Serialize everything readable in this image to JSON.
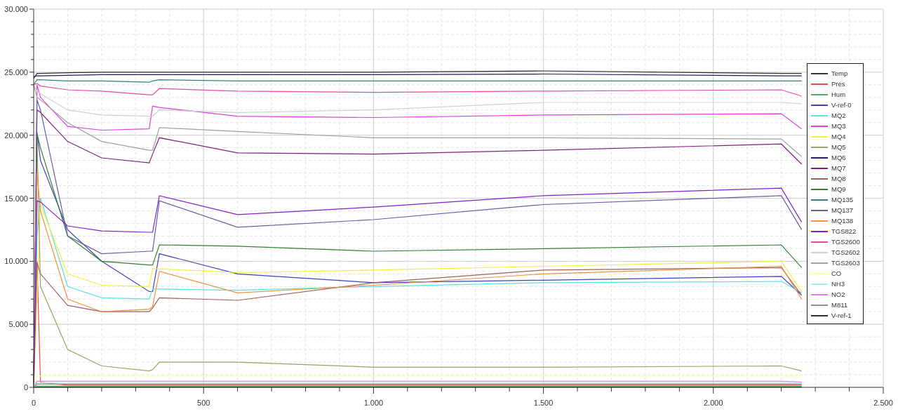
{
  "chart": {
    "chart_data": {
      "type": "line",
      "grid": true,
      "x": [
        0,
        10,
        20,
        100,
        200,
        340,
        350,
        370,
        600,
        1000,
        1500,
        2200,
        2260
      ],
      "xlim": [
        0,
        2500
      ],
      "ylim": [
        0,
        30000
      ],
      "xticks": [
        {
          "value": 0,
          "label": "0"
        },
        {
          "value": 500,
          "label": "500"
        },
        {
          "value": 1000,
          "label": "1.000"
        },
        {
          "value": 1500,
          "label": "1.500"
        },
        {
          "value": 2000,
          "label": "2.000"
        },
        {
          "value": 2500,
          "label": "2.500"
        }
      ],
      "yticks": [
        {
          "value": 0,
          "label": "0"
        },
        {
          "value": 5000,
          "label": "5.000"
        },
        {
          "value": 10000,
          "label": "10.000"
        },
        {
          "value": 15000,
          "label": "15.000"
        },
        {
          "value": 20000,
          "label": "20.000"
        },
        {
          "value": 25000,
          "label": "25.000"
        },
        {
          "value": 30000,
          "label": "30.000"
        }
      ],
      "series": [
        {
          "name": "Temp",
          "color": "#333333",
          "values": [
            0,
            20,
            20,
            20,
            20,
            20,
            20,
            20,
            20,
            20,
            20,
            20,
            20
          ]
        },
        {
          "name": "Pres",
          "color": "#e05050",
          "values": [
            0,
            10000,
            400,
            180,
            180,
            180,
            180,
            180,
            180,
            180,
            180,
            180,
            180
          ]
        },
        {
          "name": "Hum",
          "color": "#40c040",
          "values": [
            100,
            100,
            100,
            100,
            100,
            100,
            100,
            100,
            100,
            100,
            100,
            100,
            100
          ]
        },
        {
          "name": "V-ref-0",
          "color": "#4040c0",
          "values": [
            0,
            20200,
            18000,
            12500,
            10000,
            7600,
            7600,
            10600,
            9000,
            8300,
            8500,
            8800,
            7300
          ]
        },
        {
          "name": "MQ2",
          "color": "#60e0e0",
          "values": [
            0,
            12000,
            15000,
            8000,
            7100,
            7000,
            7800,
            7800,
            7700,
            8000,
            8300,
            8400,
            7500
          ]
        },
        {
          "name": "MQ3",
          "color": "#e040e0",
          "values": [
            0,
            24000,
            23000,
            20700,
            20400,
            20500,
            22300,
            22200,
            21500,
            21400,
            21600,
            21700,
            20500
          ]
        },
        {
          "name": "MQ4",
          "color": "#f0f040",
          "values": [
            0,
            null,
            14500,
            9000,
            8100,
            8000,
            9400,
            9400,
            9100,
            9300,
            9600,
            10000,
            7600
          ]
        },
        {
          "name": "MQ5",
          "color": "#a0a060",
          "values": [
            0,
            19800,
            8000,
            3000,
            1700,
            1300,
            1400,
            2000,
            2000,
            1600,
            1600,
            1700,
            1300
          ]
        },
        {
          "name": "MQ6",
          "color": "#202060",
          "values": [
            24650,
            24700,
            24700,
            24750,
            24800,
            24800,
            24800,
            24800,
            24800,
            24800,
            24850,
            24700,
            24700
          ]
        },
        {
          "name": "MQ7",
          "color": "#802080",
          "values": [
            0,
            22000,
            21800,
            19500,
            18200,
            17800,
            18500,
            19800,
            18600,
            18500,
            18800,
            19300,
            17700
          ]
        },
        {
          "name": "MQ8",
          "color": "#a06060",
          "values": [
            0,
            9900,
            9000,
            6500,
            6000,
            6000,
            6300,
            7100,
            6900,
            8300,
            9300,
            9500,
            7300
          ]
        },
        {
          "name": "MQ9",
          "color": "#308030",
          "values": [
            0,
            20100,
            19000,
            12000,
            10000,
            9700,
            9700,
            11300,
            11200,
            10800,
            11000,
            11300,
            9500
          ]
        },
        {
          "name": "MQ135",
          "color": "#308080",
          "values": [
            24000,
            24400,
            24400,
            24300,
            24300,
            24200,
            24300,
            24400,
            24300,
            24300,
            24300,
            24300,
            24300
          ]
        },
        {
          "name": "MQ137",
          "color": "#6060a0",
          "values": [
            0,
            22800,
            22000,
            12000,
            10600,
            10800,
            10800,
            14800,
            12700,
            13300,
            14500,
            15200,
            12500
          ]
        },
        {
          "name": "MQ138",
          "color": "#f09040",
          "values": [
            0,
            17000,
            14000,
            7000,
            6000,
            6200,
            6400,
            9200,
            7500,
            8100,
            9000,
            9600,
            7000
          ]
        },
        {
          "name": "TGS822",
          "color": "#8020d0",
          "values": [
            0,
            14800,
            14700,
            12800,
            12400,
            12300,
            12300,
            15200,
            13700,
            14300,
            15200,
            15800,
            13100
          ]
        },
        {
          "name": "TGS2600",
          "color": "#e050a0",
          "values": [
            24000,
            24100,
            23900,
            23600,
            23500,
            23200,
            23200,
            23700,
            23500,
            23400,
            23500,
            23600,
            23100
          ]
        },
        {
          "name": "TGS2602",
          "color": "#d0d0d0",
          "values": [
            24000,
            23500,
            23300,
            22000,
            21600,
            21500,
            21500,
            22000,
            21800,
            22000,
            22600,
            22600,
            22500
          ]
        },
        {
          "name": "TGS2603",
          "color": "#a0a0a0",
          "values": [
            24000,
            23000,
            22800,
            21000,
            19500,
            18800,
            18800,
            20600,
            20300,
            19800,
            19800,
            19700,
            18300
          ]
        },
        {
          "name": "CO",
          "color": "#ffffa0",
          "values": [
            0,
            900,
            900,
            900,
            900,
            900,
            900,
            900,
            900,
            900,
            900,
            900,
            900
          ]
        },
        {
          "name": "NH3",
          "color": "#a0f0f0",
          "values": [
            340,
            340,
            340,
            340,
            340,
            340,
            340,
            340,
            340,
            340,
            340,
            340,
            340
          ]
        },
        {
          "name": "NO2",
          "color": "#e080f0",
          "values": [
            0,
            480,
            480,
            480,
            480,
            480,
            480,
            480,
            480,
            480,
            480,
            480,
            430
          ]
        },
        {
          "name": "M811",
          "color": "#909090",
          "values": [
            0,
            260,
            260,
            260,
            260,
            260,
            260,
            260,
            260,
            260,
            260,
            260,
            260
          ]
        },
        {
          "name": "V-ref-1",
          "color": "#303030",
          "values": [
            24500,
            24900,
            24900,
            24950,
            25000,
            25000,
            25000,
            25000,
            25000,
            25000,
            25100,
            24900,
            24900
          ]
        }
      ]
    }
  }
}
